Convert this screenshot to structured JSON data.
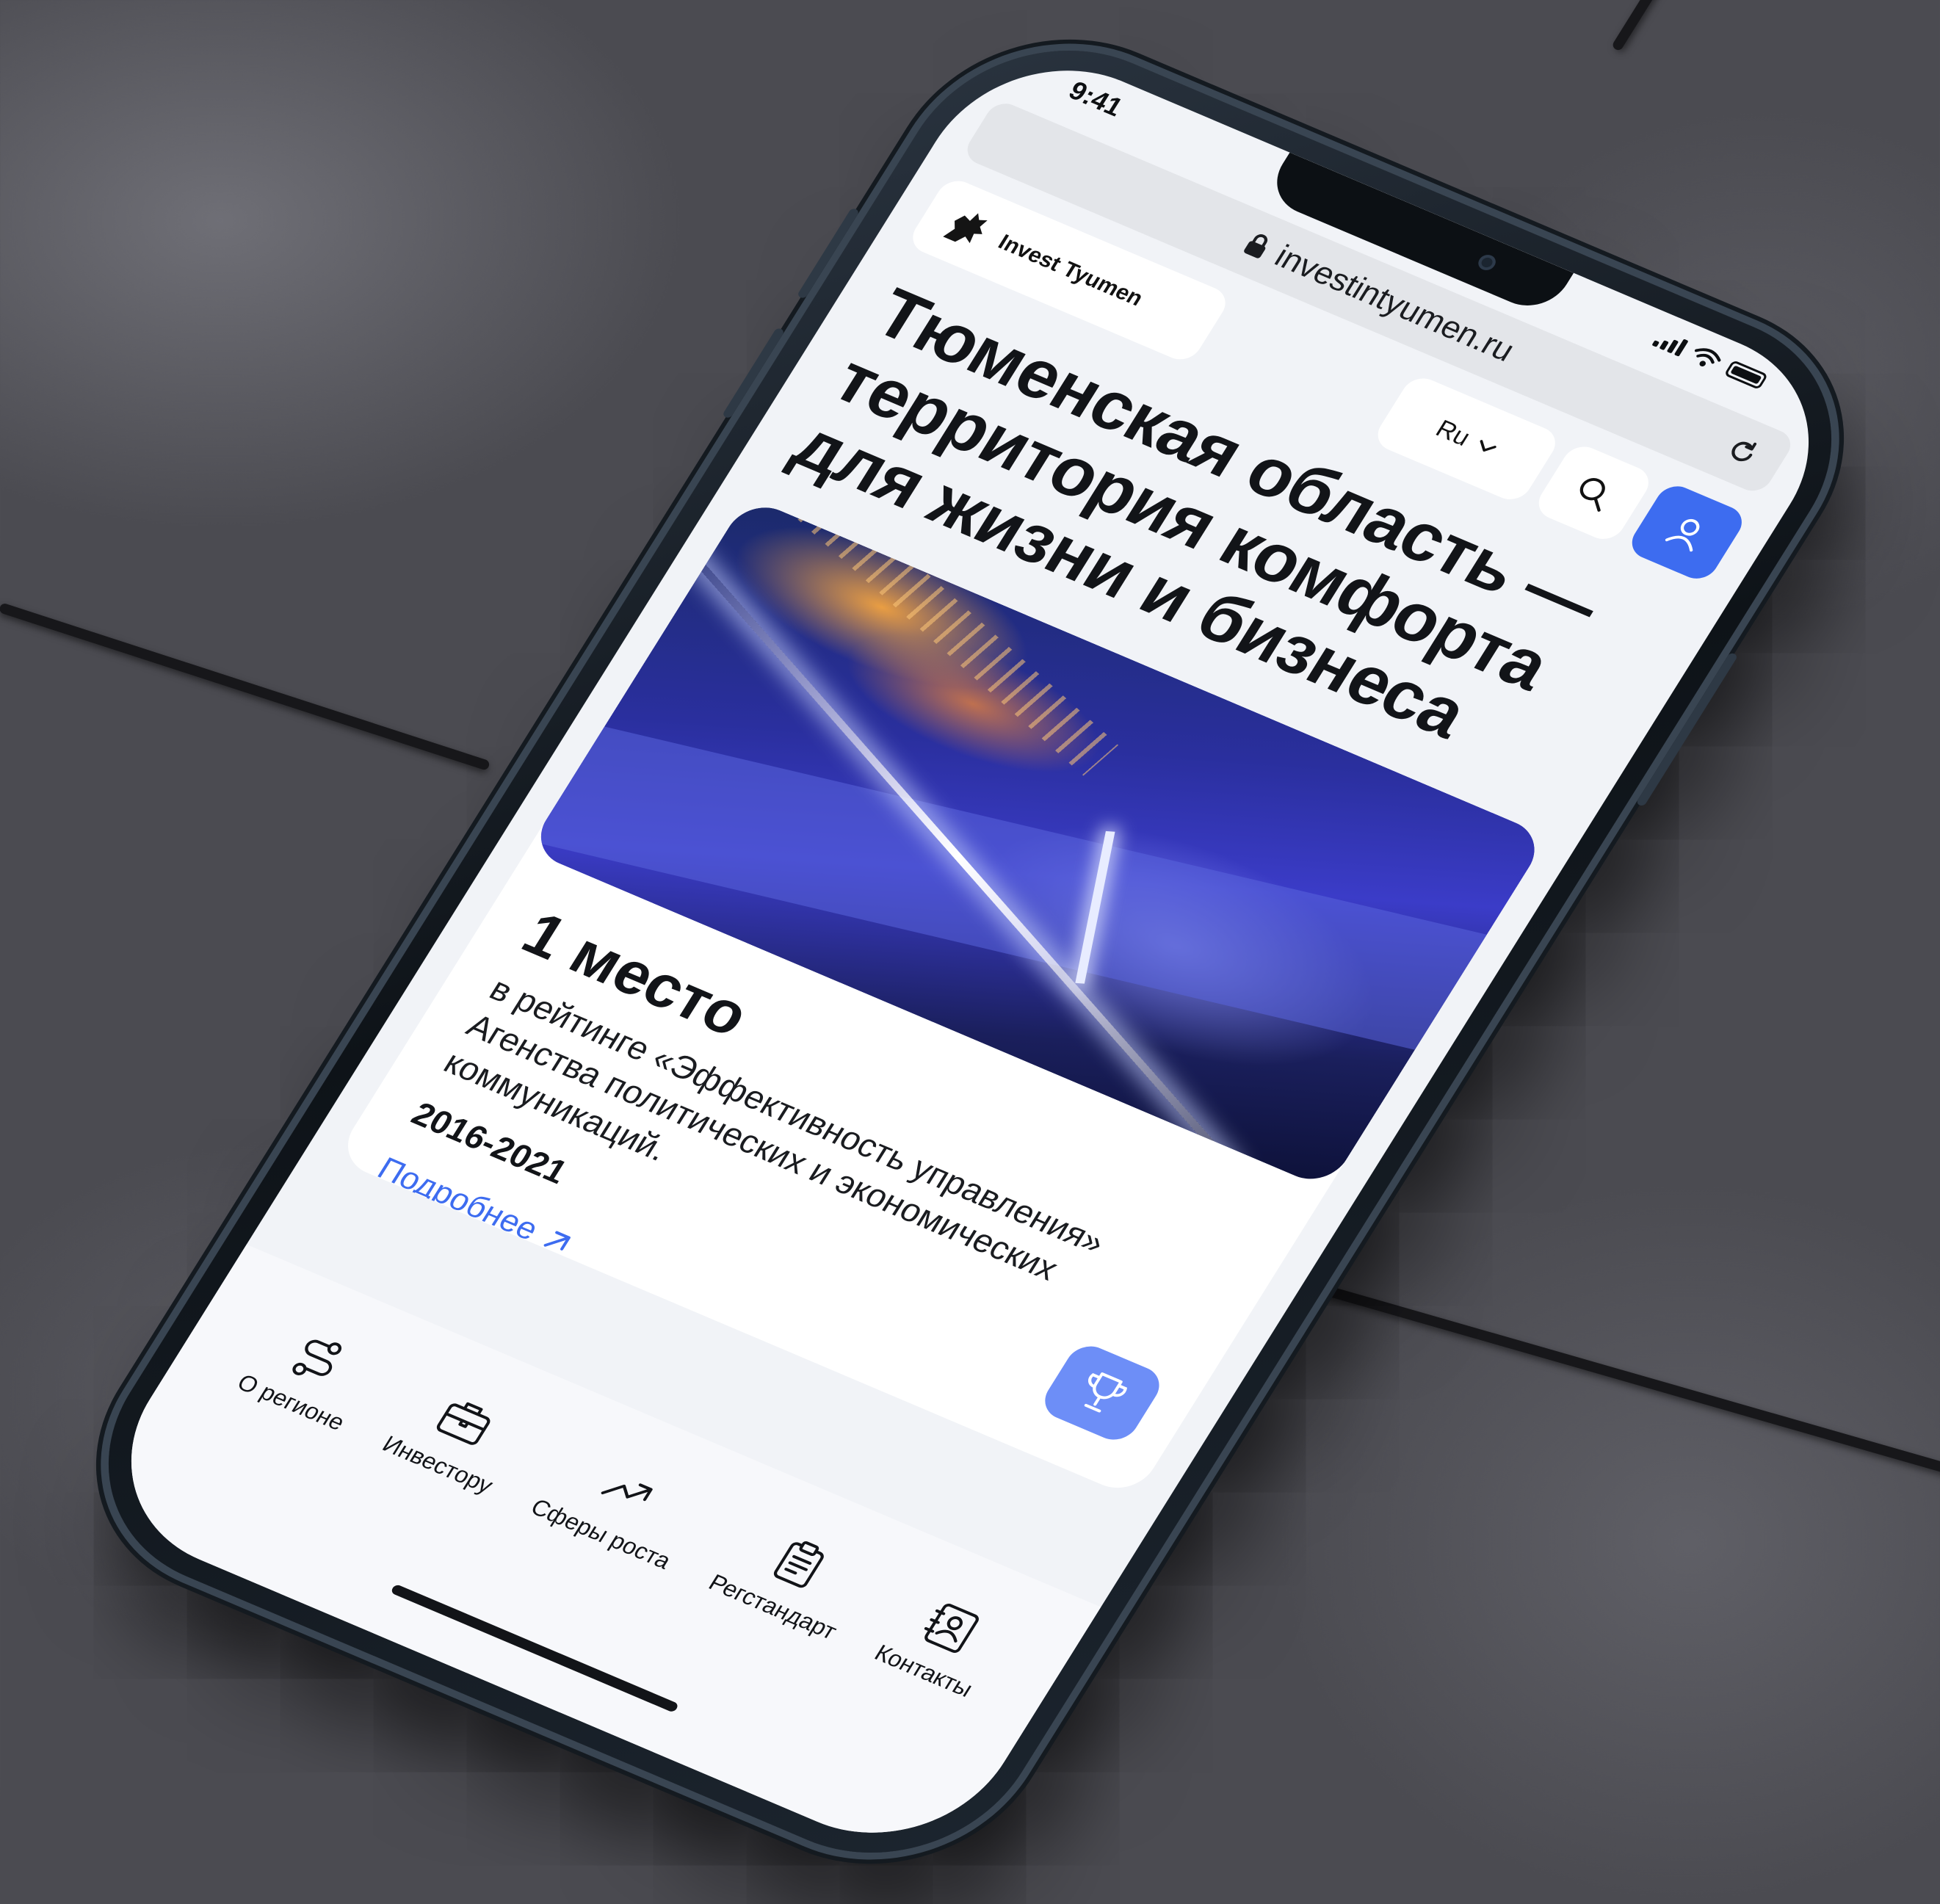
{
  "status_bar": {
    "time": "9:41"
  },
  "browser": {
    "url": "investintyumen.ru",
    "lock_icon": "lock-icon",
    "reload_icon": "reload-icon"
  },
  "header": {
    "logo_text": "Invest Tyumen",
    "language": "Ru",
    "search_icon": "search-icon",
    "profile_icon": "user-icon",
    "accent_color": "#3d6cf0"
  },
  "headline": "Тюменская область — территория комфорта для жизни и бизнеса",
  "hero_card": {
    "title": "1 место",
    "description": "в рейтинге «Эффективность управления» Агенства политических и экономических коммуникаций.",
    "years": "2016-2021",
    "link_label": "Подробнее",
    "badge_icon": "trophy-icon"
  },
  "tab_bar": {
    "items": [
      {
        "label": "О регионе",
        "icon": "route-icon"
      },
      {
        "label": "Инвестору",
        "icon": "briefcase-icon"
      },
      {
        "label": "Сферы роста",
        "icon": "trend-up-icon"
      },
      {
        "label": "Регстандарт",
        "icon": "clipboard-icon"
      },
      {
        "label": "Контакты",
        "icon": "contact-card-icon"
      }
    ]
  }
}
